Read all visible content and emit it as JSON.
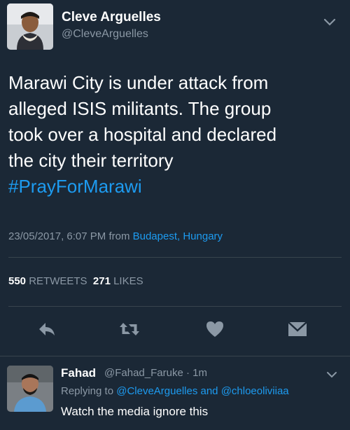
{
  "tweet": {
    "author_name": "Cleve Arguelles",
    "author_handle": "@CleveArguelles",
    "text_line1": "Marawi City is under attack from",
    "text_line2": "alleged ISIS militants. The group",
    "text_line3": "took over a hospital and declared",
    "text_line4": "the city their territory",
    "hashtag": "#PrayForMarawi",
    "timestamp": "23/05/2017, 6:07 PM from",
    "location": "Budapest, Hungary",
    "retweet_count": "550",
    "retweet_label": "RETWEETS",
    "like_count": "271",
    "like_label": "LIKES",
    "actions": [
      "reply-icon",
      "retweet-icon",
      "heart-icon",
      "dm-icon"
    ]
  },
  "reply": {
    "author_name": "Fahad",
    "author_handle": "@Fahad_Faruke · 1m",
    "replying_prefix": "Replying to",
    "replying_users": "@CleveArguelles and @chloeoliviiaa",
    "text": "Watch the media ignore this"
  },
  "colors": {
    "background": "#1b2836",
    "accent": "#1d9bf0",
    "muted": "#8b98a5",
    "divider": "#38444d"
  }
}
